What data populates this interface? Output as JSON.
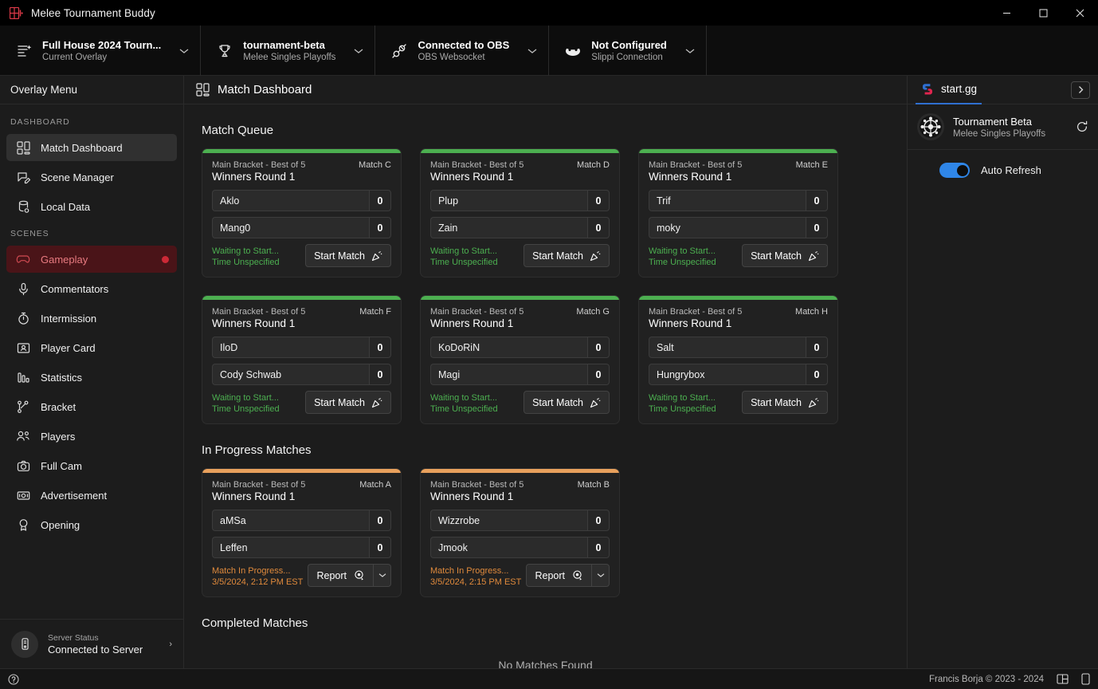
{
  "window": {
    "title": "Melee Tournament Buddy",
    "app_icon": "melee-buddy-logo-icon",
    "minimize": "—",
    "maximize": "☐",
    "close": "✕"
  },
  "toolbar": {
    "items": [
      {
        "icon": "overlay-document-icon",
        "title": "Full House 2024 Tourn...",
        "subtitle": "Current Overlay",
        "chevron": "⌄"
      },
      {
        "icon": "trophy-icon",
        "title": "tournament-beta",
        "subtitle": "Melee Singles Playoffs",
        "chevron": "⌄"
      },
      {
        "icon": "plug-connector-icon",
        "title": "Connected to OBS",
        "subtitle": "OBS Websocket",
        "chevron": "⌄"
      },
      {
        "icon": "slippi-fish-icon",
        "title": "Not Configured",
        "subtitle": "Slippi Connection",
        "chevron": "⌄"
      }
    ]
  },
  "sidebar": {
    "header": "Overlay Menu",
    "groups": [
      {
        "label": "DASHBOARD",
        "items": [
          {
            "label": "Match Dashboard",
            "icon": "dashboard-grid-icon",
            "active": true,
            "live": false
          },
          {
            "label": "Scene Manager",
            "icon": "scene-edit-icon",
            "active": false,
            "live": false
          },
          {
            "label": "Local Data",
            "icon": "database-icon",
            "active": false,
            "live": false
          }
        ]
      },
      {
        "label": "SCENES",
        "items": [
          {
            "label": "Gameplay",
            "icon": "gamepad-icon",
            "active": false,
            "live": true
          },
          {
            "label": "Commentators",
            "icon": "microphone-icon",
            "active": false,
            "live": false
          },
          {
            "label": "Intermission",
            "icon": "stopwatch-icon",
            "active": false,
            "live": false
          },
          {
            "label": "Player Card",
            "icon": "player-card-icon",
            "active": false,
            "live": false
          },
          {
            "label": "Statistics",
            "icon": "bar-chart-icon",
            "active": false,
            "live": false
          },
          {
            "label": "Bracket",
            "icon": "bracket-tree-icon",
            "active": false,
            "live": false
          },
          {
            "label": "Players",
            "icon": "people-icon",
            "active": false,
            "live": false
          },
          {
            "label": "Full Cam",
            "icon": "camera-icon",
            "active": false,
            "live": false
          },
          {
            "label": "Advertisement",
            "icon": "banknote-icon",
            "active": false,
            "live": false
          },
          {
            "label": "Opening",
            "icon": "award-ribbon-icon",
            "active": false,
            "live": false
          }
        ]
      }
    ],
    "footer": {
      "icon": "server-icon",
      "label": "Server Status",
      "value": "Connected to Server",
      "chevron": "›"
    }
  },
  "main": {
    "header_icon": "dashboard-grid-icon",
    "header_title": "Match Dashboard",
    "sections": [
      {
        "title": "Match Queue"
      },
      {
        "title": "In Progress Matches"
      },
      {
        "title": "Completed Matches",
        "empty_text": "No Matches Found"
      }
    ],
    "queue_matches": [
      {
        "bracket": "Main Bracket - Best of 5",
        "match_id": "Match C",
        "round": "Winners Round 1",
        "player1": "Aklo",
        "score1": "0",
        "player2": "Mang0",
        "score2": "0",
        "status_main": "Waiting to Start...",
        "status_sub": "Time Unspecified",
        "action_label": "Start Match",
        "action_icon": "confetti-icon",
        "stripe_color": "#4caf50"
      },
      {
        "bracket": "Main Bracket - Best of 5",
        "match_id": "Match D",
        "round": "Winners Round 1",
        "player1": "Plup",
        "score1": "0",
        "player2": "Zain",
        "score2": "0",
        "status_main": "Waiting to Start...",
        "status_sub": "Time Unspecified",
        "action_label": "Start Match",
        "action_icon": "confetti-icon",
        "stripe_color": "#4caf50"
      },
      {
        "bracket": "Main Bracket - Best of 5",
        "match_id": "Match E",
        "round": "Winners Round 1",
        "player1": "Trif",
        "score1": "0",
        "player2": "moky",
        "score2": "0",
        "status_main": "Waiting to Start...",
        "status_sub": "Time Unspecified",
        "action_label": "Start Match",
        "action_icon": "confetti-icon",
        "stripe_color": "#4caf50"
      },
      {
        "bracket": "Main Bracket - Best of 5",
        "match_id": "Match F",
        "round": "Winners Round 1",
        "player1": "IloD",
        "score1": "0",
        "player2": "Cody Schwab",
        "score2": "0",
        "status_main": "Waiting to Start...",
        "status_sub": "Time Unspecified",
        "action_label": "Start Match",
        "action_icon": "confetti-icon",
        "stripe_color": "#4caf50"
      },
      {
        "bracket": "Main Bracket - Best of 5",
        "match_id": "Match G",
        "round": "Winners Round 1",
        "player1": "KoDoRiN",
        "score1": "0",
        "player2": "Magi",
        "score2": "0",
        "status_main": "Waiting to Start...",
        "status_sub": "Time Unspecified",
        "action_label": "Start Match",
        "action_icon": "confetti-icon",
        "stripe_color": "#4caf50"
      },
      {
        "bracket": "Main Bracket - Best of 5",
        "match_id": "Match H",
        "round": "Winners Round 1",
        "player1": "Salt",
        "score1": "0",
        "player2": "Hungrybox",
        "score2": "0",
        "status_main": "Waiting to Start...",
        "status_sub": "Time Unspecified",
        "action_label": "Start Match",
        "action_icon": "confetti-icon",
        "stripe_color": "#4caf50"
      }
    ],
    "inprogress_matches": [
      {
        "bracket": "Main Bracket - Best of 5",
        "match_id": "Match A",
        "round": "Winners Round 1",
        "player1": "aMSa",
        "score1": "0",
        "player2": "Leffen",
        "score2": "0",
        "status_main": "Match In Progress...",
        "status_sub": "3/5/2024, 2:12 PM EST",
        "action_label": "Report",
        "action_icon": "report-badge-icon",
        "action_caret": "⌄",
        "stripe_color": "#e8a05c"
      },
      {
        "bracket": "Main Bracket - Best of 5",
        "match_id": "Match B",
        "round": "Winners Round 1",
        "player1": "Wizzrobe",
        "score1": "0",
        "player2": "Jmook",
        "score2": "0",
        "status_main": "Match In Progress...",
        "status_sub": "3/5/2024, 2:15 PM EST",
        "action_label": "Report",
        "action_icon": "report-badge-icon",
        "action_caret": "⌄",
        "stripe_color": "#e8a05c"
      }
    ]
  },
  "rightpanel": {
    "tab_label": "start.gg",
    "tab_icon": "startgg-logo-icon",
    "expand_icon": "›",
    "tournament_name": "Tournament Beta",
    "tournament_sub": "Melee Singles Playoffs",
    "refresh_icon": "refresh-icon",
    "toggle_label": "Auto Refresh",
    "toggle_on": true
  },
  "statusbar": {
    "help_icon": "help-circle-icon",
    "copyright": "Francis Borja © 2023 - 2024",
    "layout_icon": "layout-panel-icon",
    "device_icon": "device-icon"
  },
  "colors": {
    "accent_blue": "#2f86e8",
    "live_red": "#cc2936",
    "queue_green": "#4caf50",
    "progress_orange": "#e8a05c",
    "bg": "#1c1c1c",
    "card_bg": "#212121"
  }
}
